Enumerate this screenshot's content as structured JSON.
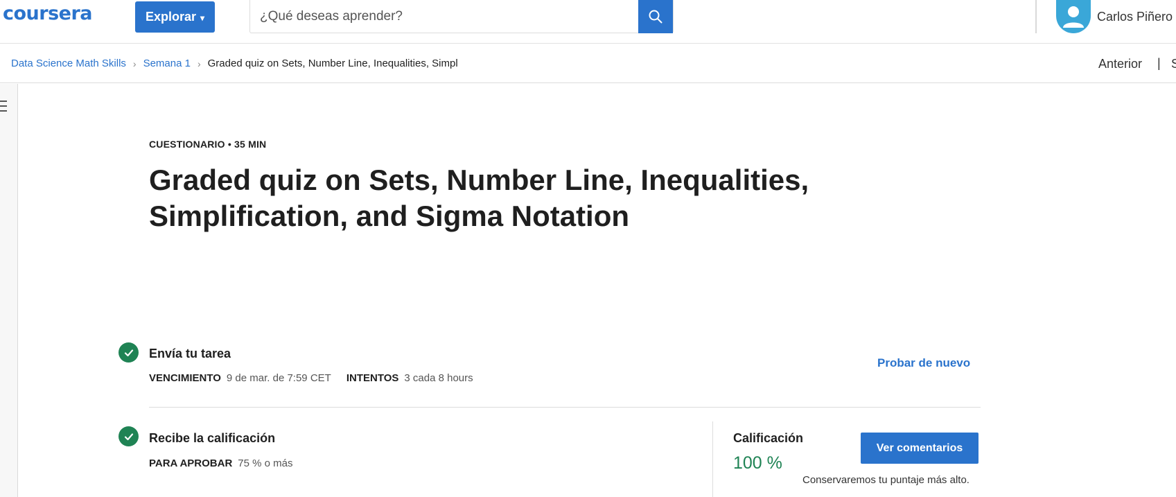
{
  "header": {
    "logo": "coursera",
    "explore_label": "Explorar",
    "search_placeholder": "¿Qué deseas aprender?",
    "user_name": "Carlos Piñero"
  },
  "breadcrumb": {
    "items": [
      "Data Science Math Skills",
      "Semana 1"
    ],
    "current": "Graded quiz on Sets, Number Line, Inequalities, Simpl",
    "prev_label": "Anterior",
    "separator": "|",
    "next_label_partial": "S"
  },
  "quiz": {
    "eyebrow": "CUESTIONARIO • 35 MIN",
    "title": "Graded quiz on Sets, Number Line, Inequalities, Simplification, and Sigma Notation"
  },
  "submit_step": {
    "title": "Envía tu tarea",
    "due_label": "VENCIMIENTO",
    "due_value": "9 de mar. de 7:59 CET",
    "attempts_label": "INTENTOS",
    "attempts_value": "3 cada 8 hours",
    "retry_label": "Probar de nuevo"
  },
  "grade_step": {
    "title": "Recibe la calificación",
    "pass_label": "PARA APROBAR",
    "pass_value": "75 % o más",
    "grade_label": "Calificación",
    "grade_value": "100 %",
    "feedback_label": "Ver comentarios",
    "keep_note": "Conservaremos tu puntaje más alto."
  },
  "colors": {
    "brand_blue": "#2a73cc",
    "success_green": "#1f8354",
    "avatar_blue": "#3aa7d8"
  }
}
